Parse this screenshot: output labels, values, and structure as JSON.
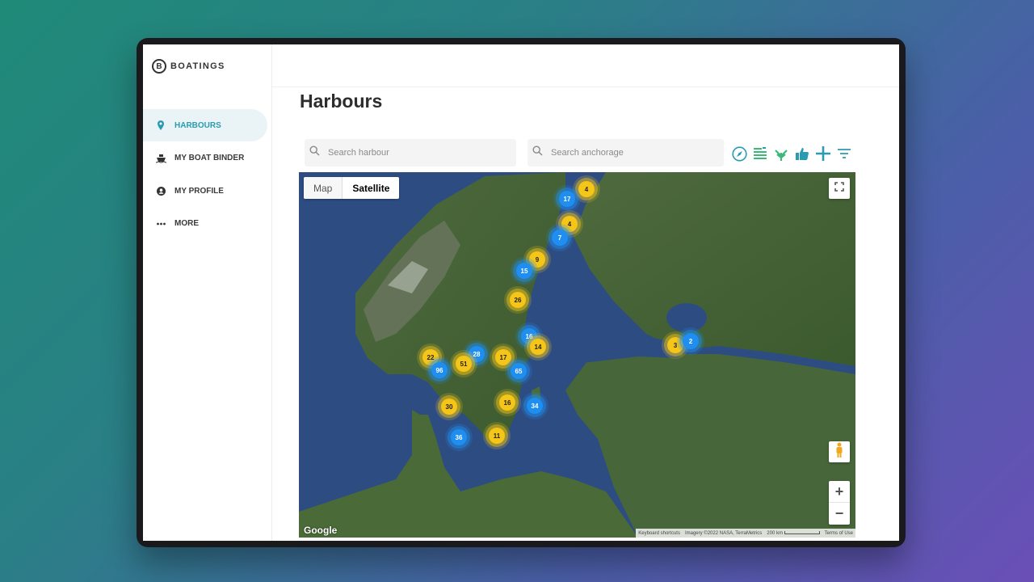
{
  "app": {
    "brand": "BOATINGS",
    "brand_mark": "B"
  },
  "sidebar": {
    "items": [
      {
        "label": "HARBOURS",
        "icon": "location-pin-icon",
        "active": true
      },
      {
        "label": "MY BOAT BINDER",
        "icon": "ship-icon",
        "active": false
      },
      {
        "label": "MY PROFILE",
        "icon": "user-icon",
        "active": false
      },
      {
        "label": "MORE",
        "icon": "more-icon",
        "active": false
      }
    ]
  },
  "page": {
    "title": "Harbours"
  },
  "search": {
    "harbour_placeholder": "Search harbour",
    "anchorage_placeholder": "Search anchorage"
  },
  "toolbar": {
    "icons": [
      "compass-icon",
      "waves-icon",
      "anchor-plant-icon",
      "thumbs-up-icon",
      "add-icon",
      "filter-icon"
    ],
    "accent": "#2a9bb0",
    "green": "#3cb878"
  },
  "map": {
    "type_map_label": "Map",
    "type_satellite_label": "Satellite",
    "active_type": "Satellite",
    "attribution": {
      "shortcuts": "Keyboard shortcuts",
      "imagery": "Imagery ©2022 NASA, TerraMetrics",
      "scale": "200 km",
      "terms": "Terms of Use"
    },
    "google": "Google",
    "zoom_in": "+",
    "zoom_out": "−",
    "cluster_colors": {
      "yellow": "#f5c518",
      "blue": "#1e8ef0"
    },
    "clusters": [
      {
        "count": "4",
        "color": "yellow"
      },
      {
        "count": "17",
        "color": "blue"
      },
      {
        "count": "4",
        "color": "yellow"
      },
      {
        "count": "7",
        "color": "blue"
      },
      {
        "count": "9",
        "color": "yellow"
      },
      {
        "count": "15",
        "color": "blue"
      },
      {
        "count": "26",
        "color": "yellow"
      },
      {
        "count": "16",
        "color": "blue"
      },
      {
        "count": "14",
        "color": "yellow"
      },
      {
        "count": "22",
        "color": "yellow"
      },
      {
        "count": "28",
        "color": "blue"
      },
      {
        "count": "17",
        "color": "yellow"
      },
      {
        "count": "51",
        "color": "yellow"
      },
      {
        "count": "96",
        "color": "blue"
      },
      {
        "count": "65",
        "color": "blue"
      },
      {
        "count": "3",
        "color": "yellow"
      },
      {
        "count": "2",
        "color": "blue"
      },
      {
        "count": "30",
        "color": "yellow"
      },
      {
        "count": "16",
        "color": "yellow"
      },
      {
        "count": "34",
        "color": "blue"
      },
      {
        "count": "36",
        "color": "blue"
      },
      {
        "count": "11",
        "color": "yellow"
      }
    ]
  }
}
